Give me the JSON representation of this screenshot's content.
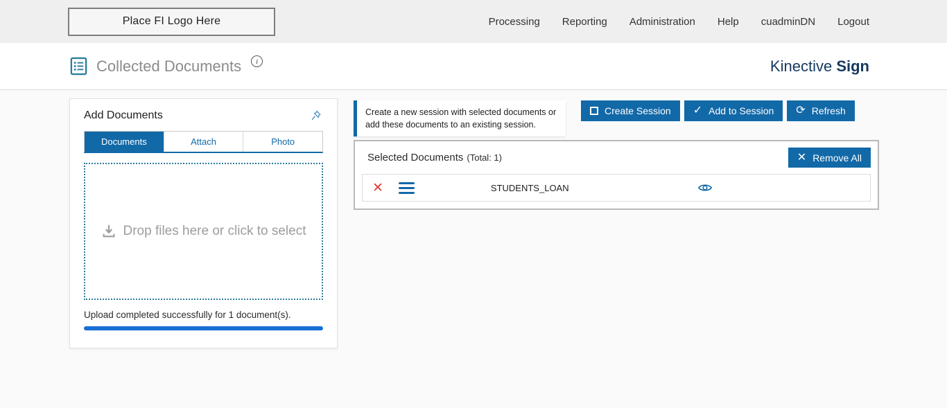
{
  "top_nav": {
    "logo_text": "Place FI Logo Here",
    "items": [
      "Processing",
      "Reporting",
      "Administration",
      "Help",
      "cuadminDN",
      "Logout"
    ]
  },
  "header": {
    "title": "Collected Documents",
    "info_icon": "i",
    "brand_first": "Kinective",
    "brand_second": "Sign"
  },
  "add_documents": {
    "title": "Add Documents",
    "tabs": [
      {
        "label": "Documents",
        "active": true
      },
      {
        "label": "Attach",
        "active": false
      },
      {
        "label": "Photo",
        "active": false
      }
    ],
    "dropzone_text": "Drop files here or click to select",
    "status_text": "Upload completed successfully for 1 document(s)."
  },
  "session": {
    "note_text": "Create a new session with selected documents or add these documents to an existing session.",
    "create_label": "Create Session",
    "add_label": "Add to Session",
    "refresh_label": "Refresh"
  },
  "selected_documents": {
    "title": "Selected Documents",
    "total_label": "(Total: 1)",
    "remove_all_label": "Remove All",
    "rows": [
      {
        "name": "STUDENTS_LOAN"
      }
    ]
  },
  "icons": {
    "check": "✓",
    "refresh": "⟳",
    "x": "✕"
  },
  "colors": {
    "accent_blue": "#1269a8",
    "brand_navy": "#16395e",
    "teal_icon": "#2b7d9c",
    "progress_blue": "#1a6fd4",
    "delete_red": "#e03c31"
  }
}
